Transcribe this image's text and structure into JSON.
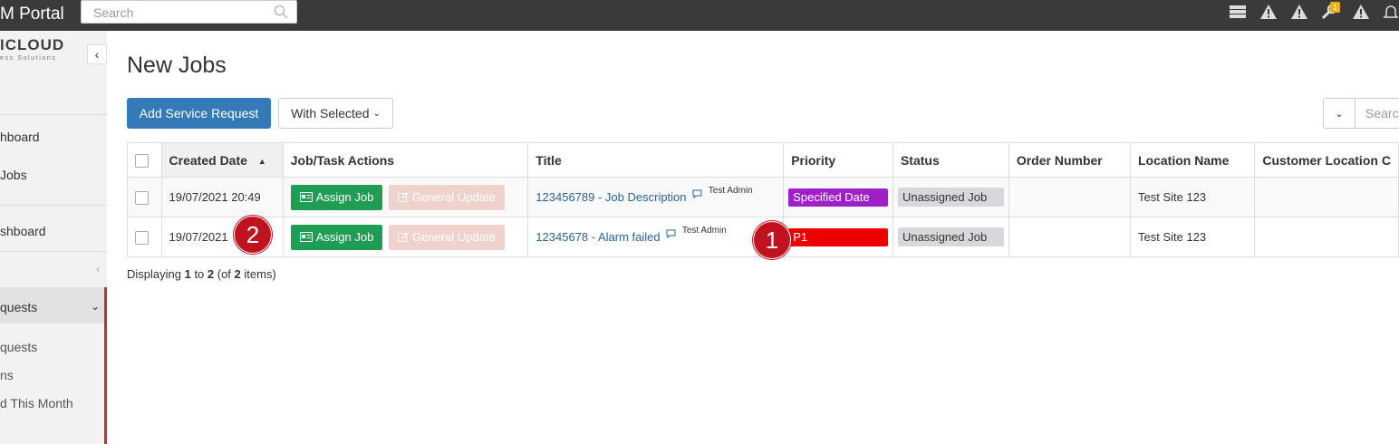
{
  "header": {
    "app_title": "M Portal",
    "search_placeholder": "Search",
    "icons": [
      "server-icon",
      "warning-icon",
      "warning-icon",
      "wrench-icon",
      "warning-icon",
      "bell-icon"
    ],
    "wrench_badge": "1"
  },
  "sidebar": {
    "logo_text": "ICLOUD",
    "logo_sub": "ess Solutions",
    "collapse_glyph": "‹",
    "items": [
      {
        "label": "hboard"
      },
      {
        "label": "Jobs"
      },
      {
        "label": "shboard"
      },
      {
        "label": "quests"
      }
    ],
    "subitems": [
      {
        "label": "quests"
      },
      {
        "label": "ns"
      },
      {
        "label": "d This Month"
      }
    ]
  },
  "main": {
    "page_title": "New Jobs",
    "add_button": "Add Service Request",
    "with_selected": "With Selected",
    "search_placeholder": "Search"
  },
  "table": {
    "columns": [
      "Created Date",
      "Job/Task Actions",
      "Title",
      "Priority",
      "Status",
      "Order Number",
      "Location Name",
      "Customer Location C"
    ],
    "rows": [
      {
        "created": "19/07/2021 20:49",
        "assign": "Assign Job",
        "general": "General Update",
        "title": "123456789 - Job Description",
        "by": "Test Admin",
        "priority": "Specified Date",
        "priority_color": "#a020c8",
        "status": "Unassigned Job",
        "order": "",
        "location": "Test Site 123",
        "customer": ""
      },
      {
        "created": "19/07/2021",
        "assign": "Assign Job",
        "general": "General Update",
        "title": "12345678 - Alarm failed",
        "by": "Test Admin",
        "priority": "P1",
        "priority_color": "#ee0000",
        "status": "Unassigned Job",
        "order": "",
        "location": "Test Site 123",
        "customer": ""
      }
    ]
  },
  "footer": {
    "prefix": "Displaying ",
    "from": "1",
    "to_word": " to ",
    "to": "2",
    "of_word": " (of ",
    "total": "2",
    "suffix": " items)"
  },
  "annotations": {
    "marker_1": "1",
    "marker_2": "2"
  }
}
